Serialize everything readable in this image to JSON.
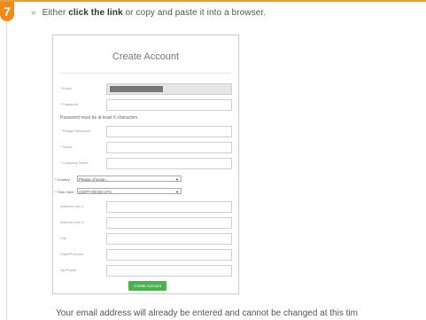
{
  "step": {
    "number": "7"
  },
  "instruction": {
    "bullet": "»",
    "prefix": "Either",
    "link_phrase": "click the link",
    "suffix": "or copy and paste it into a browser."
  },
  "form": {
    "title": "Create Account",
    "fields": [
      {
        "label": "* Email",
        "filled": true
      },
      {
        "label": "* Password",
        "filled": false
      }
    ],
    "password_note": "Password must be at least 6 characters",
    "fields2": [
      {
        "label": "* Retype Password"
      },
      {
        "label": "* Name"
      },
      {
        "label": "* Company Name"
      }
    ],
    "country": {
      "label": "* Country",
      "selected": "Please choose..."
    },
    "timezone": {
      "label": "* Time Zone",
      "selected": "(GMT+00:00) UTC"
    },
    "address_fields": [
      {
        "label": "Address Line 1"
      },
      {
        "label": "Address Line 2"
      },
      {
        "label": "City"
      },
      {
        "label": "State/Province"
      },
      {
        "label": "Zip/Postal"
      }
    ],
    "submit_label": "Create Account"
  },
  "footer_text": "Your email address will already be entered and cannot be changed at this tim",
  "colors": {
    "accent": "#ee8a1b",
    "button": "#4caf50"
  }
}
